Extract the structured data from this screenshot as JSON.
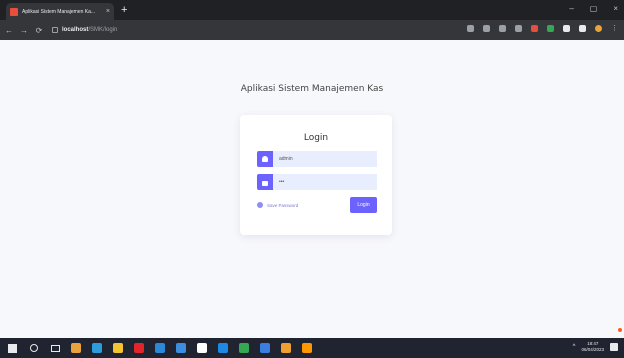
{
  "browser": {
    "tab_title": "Aplikasi Sistem Manajemen Ka...",
    "tab_close": "×",
    "new_tab": "+",
    "url_host": "localhost",
    "url_path": "/SMK/login",
    "nav_back": "←",
    "nav_forward": "→",
    "nav_reload": "⟳",
    "win_minimize": "–",
    "win_maximize": "▢",
    "win_close": "×",
    "accent_color": "#35363a"
  },
  "app": {
    "title": "Aplikasi Sistem Manajemen Kas",
    "login_heading": "Login",
    "username_value": "admin",
    "password_value": "•••",
    "remember_label": "Save Password",
    "login_button": "Login",
    "accent": "#6c63ff"
  },
  "taskbar": {
    "time": "18:47",
    "date": "06/04/2023",
    "chevron": "^",
    "apps": [
      {
        "icon": "file-explorer-icon",
        "color": "#e8a33d"
      },
      {
        "icon": "edge-icon",
        "color": "#2e9bdc"
      },
      {
        "icon": "folder-icon",
        "color": "#f4c430"
      },
      {
        "icon": "opera-icon",
        "color": "#e2252b"
      },
      {
        "icon": "store-icon",
        "color": "#2b88d8"
      },
      {
        "icon": "mail-icon",
        "color": "#3c8fe0"
      },
      {
        "icon": "terminal-icon",
        "color": "#ffffff"
      },
      {
        "icon": "vscode-icon",
        "color": "#1e88e5"
      },
      {
        "icon": "chrome-icon",
        "color": "#34a853"
      },
      {
        "icon": "photos-icon",
        "color": "#3c7ee0"
      },
      {
        "icon": "settings-icon",
        "color": "#f0a030"
      },
      {
        "icon": "sublime-icon",
        "color": "#ff9800"
      }
    ]
  }
}
